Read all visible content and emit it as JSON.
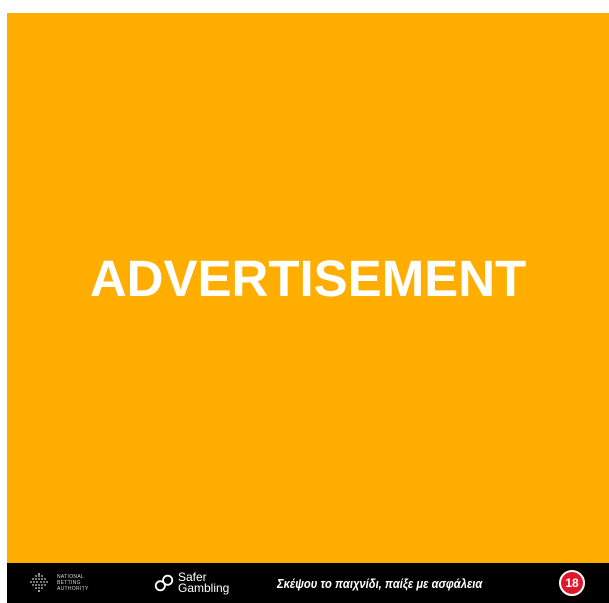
{
  "ad": {
    "label": "ADVERTISEMENT",
    "background_color": "#FFAE00"
  },
  "footer": {
    "nba_logo_icon": "national-betting-authority-icon",
    "nba_lines": [
      "NATIONAL",
      "BETTING",
      "AUTHORITY"
    ],
    "safer_icon": "safer-gambling-icon",
    "safer_line1": "Safer",
    "safer_line2": "Gambling",
    "slogan": "Σκέψου το παιχνίδι, παίξε με ασφάλεια",
    "age_badge": "18",
    "age_badge_color": "#E0182D"
  }
}
